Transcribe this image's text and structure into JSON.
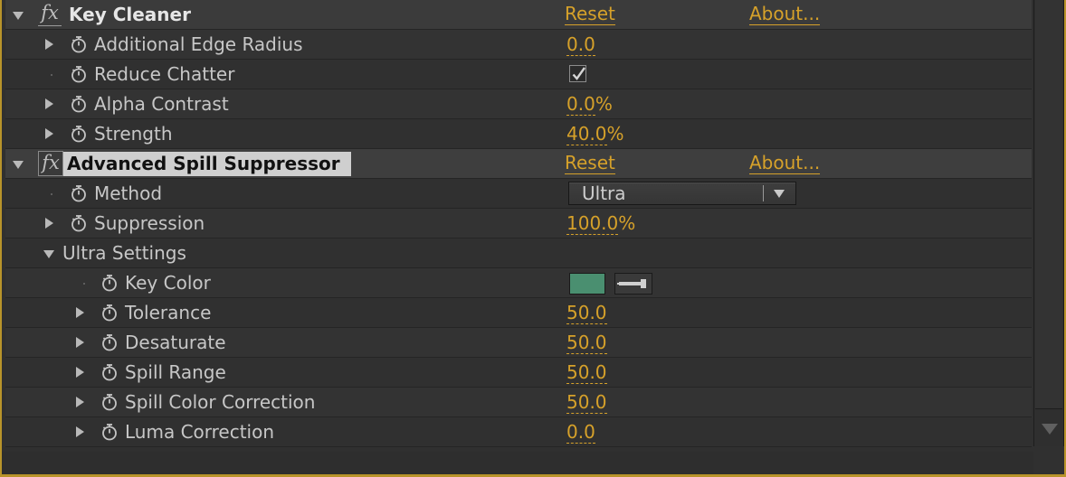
{
  "effects": [
    {
      "name": "Key Cleaner",
      "fx_label": "fx",
      "reset_label": "Reset",
      "about_label": "About...",
      "properties": [
        {
          "label": "Additional Edge Radius",
          "value": "0.0",
          "unit": ""
        },
        {
          "label": "Reduce Chatter",
          "checked": true
        },
        {
          "label": "Alpha Contrast",
          "value": "0.0",
          "unit": "%"
        },
        {
          "label": "Strength",
          "value": "40.0",
          "unit": "%"
        }
      ]
    },
    {
      "name": "Advanced Spill Suppressor",
      "fx_label": "fx",
      "reset_label": "Reset",
      "about_label": "About...",
      "properties": [
        {
          "label": "Method",
          "dropdown_value": "Ultra"
        },
        {
          "label": "Suppression",
          "value": "100.0",
          "unit": "%"
        }
      ],
      "group": {
        "label": "Ultra Settings",
        "properties": [
          {
            "label": "Key Color",
            "swatch_color": "#4a8f70"
          },
          {
            "label": "Tolerance",
            "value": "50.0",
            "unit": ""
          },
          {
            "label": "Desaturate",
            "value": "50.0",
            "unit": ""
          },
          {
            "label": "Spill Range",
            "value": "50.0",
            "unit": ""
          },
          {
            "label": "Spill Color Correction",
            "value": "50.0",
            "unit": ""
          },
          {
            "label": "Luma Correction",
            "value": "0.0",
            "unit": ""
          }
        ]
      }
    }
  ],
  "colors": {
    "accent": "#d6a12a",
    "panel_border": "#b8942a",
    "key_color": "#4a8f70"
  },
  "icons": {
    "stopwatch": "stopwatch-icon",
    "twirl": "twirl-arrow-icon",
    "eyedropper": "eyedropper-icon",
    "dropdown": "chevron-down-icon",
    "checkmark": "checkmark-icon"
  }
}
